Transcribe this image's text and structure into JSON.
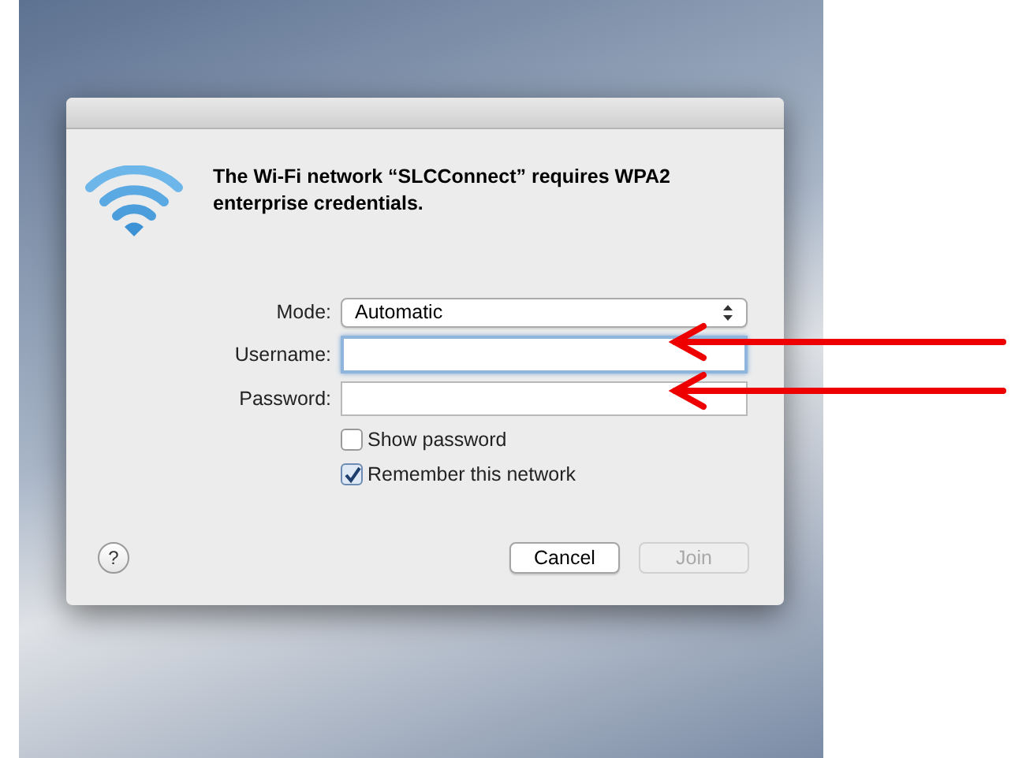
{
  "dialog": {
    "message": "The Wi-Fi network “SLCConnect” requires WPA2 enterprise credentials.",
    "fields": [
      {
        "kind": "select",
        "label": "Mode:",
        "value": "Automatic"
      },
      {
        "kind": "text",
        "label": "Username:",
        "focused": true
      },
      {
        "kind": "text",
        "label": "Password:",
        "focused": false
      }
    ],
    "checkboxes": [
      {
        "label": "Show password",
        "checked": false
      },
      {
        "label": "Remember this network",
        "checked": true
      }
    ],
    "help": "?",
    "buttons": [
      {
        "label": "Cancel",
        "disabled": false
      },
      {
        "label": "Join",
        "disabled": true
      }
    ]
  },
  "annotations": [
    {
      "kind": "arrow"
    },
    {
      "kind": "arrow"
    }
  ]
}
